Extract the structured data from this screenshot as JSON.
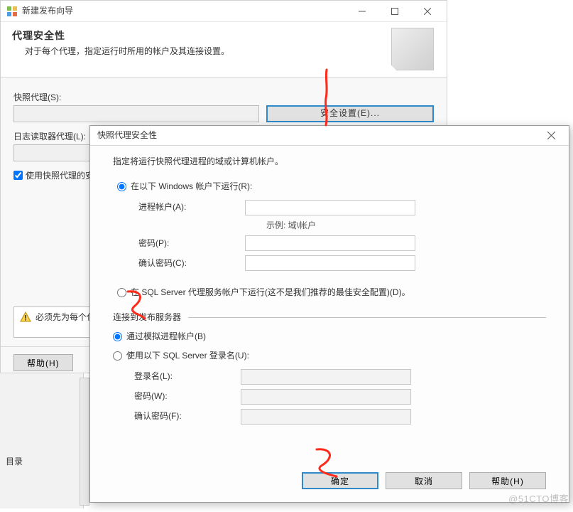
{
  "wizard": {
    "title": "新建发布向导",
    "head_title": "代理安全性",
    "head_sub": "对于每个代理，指定运行时所用的帐户及其连接设置。",
    "snapshot_label": "快照代理(S):",
    "logreader_label": "日志读取器代理(L):",
    "security_btn": "安全设置(E)...",
    "use_snapshot_chk": "使用快照代理的安",
    "warn_text": "必须先为每个代",
    "help_btn": "帮助(H)"
  },
  "modal": {
    "title": "快照代理安全性",
    "instr": "指定将运行快照代理进程的域或计算机帐户。",
    "opt_windows": "在以下 Windows 帐户下运行(R):",
    "proc_account": "进程帐户(A):",
    "example": "示例: 域\\帐户",
    "password": "密码(P):",
    "confirm_pw": "确认密码(C):",
    "opt_sqlagent": "在 SQL Server 代理服务帐户下运行(这不是我们推荐的最佳安全配置)(D)。",
    "connect_legend": "连接到发布服务器",
    "opt_impersonate": "通过模拟进程帐户(B)",
    "opt_sqllogin": "使用以下 SQL Server 登录名(U):",
    "login": "登录名(L):",
    "pw2": "密码(W):",
    "confirm_pw2": "确认密码(F):",
    "ok": "确定",
    "cancel": "取消",
    "help": "帮助(H)"
  },
  "ide": {
    "label": "目录"
  },
  "watermark": "@51CTO博客"
}
